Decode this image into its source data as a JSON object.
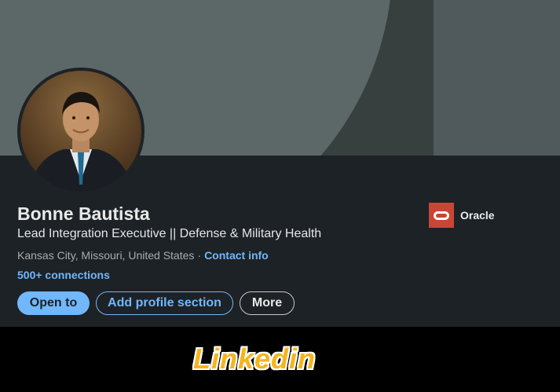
{
  "profile": {
    "name": "Bonne Bautista",
    "headline": "Lead Integration Executive || Defense & Military Health",
    "location": "Kansas City, Missouri, United States",
    "separator": "·",
    "contact_info_label": "Contact info",
    "connections_label": "500+ connections"
  },
  "actions": {
    "open_to_label": "Open to",
    "add_section_label": "Add profile section",
    "more_label": "More"
  },
  "company": {
    "name": "Oracle",
    "logo_icon": "oracle-logo-icon",
    "logo_color": "#c74634"
  },
  "caption": {
    "text": "Linkedin",
    "color": "#f5b51c"
  },
  "colors": {
    "card_background": "#1d2226",
    "accent": "#71b7fb",
    "banner": "#505a5d"
  }
}
